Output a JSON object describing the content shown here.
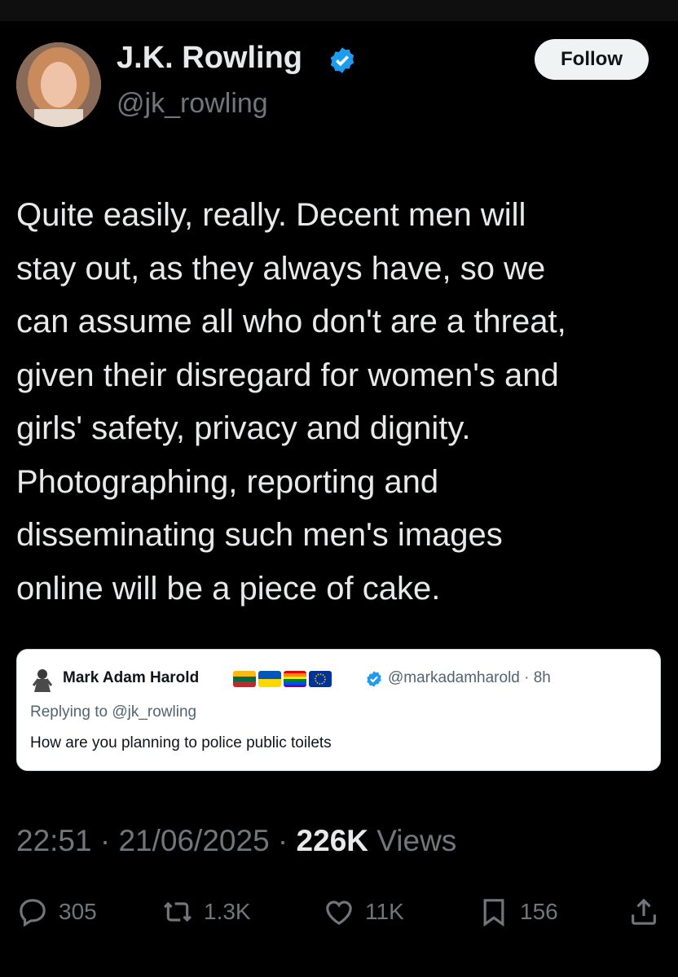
{
  "author": {
    "name": "J.K. Rowling",
    "handle": "@jk_rowling"
  },
  "follow_label": "Follow",
  "tweet_text": "Quite easily, really. Decent men will\nstay out, as they always have, so we\ncan assume all who don't are a threat,\ngiven their disregard for women's and\ngirls' safety, privacy and dignity.\nPhotographing, reporting and\ndisseminating such men's images\nonline will be a piece of cake.",
  "quote": {
    "name": "Mark Adam Harold",
    "handle_time": "@markadamharold · 8h",
    "replying": "Replying to @jk_rowling",
    "text": "How are you planning to police public toilets"
  },
  "meta": {
    "time": "22:51 · 21/06/2025 · ",
    "views_count": "226K",
    "views_label": " Views"
  },
  "stats": {
    "replies": "305",
    "reposts": "1.3K",
    "likes": "11K",
    "bookmarks": "156"
  },
  "colors": {
    "background": "#000000",
    "verified_blue": "#1d9bf0",
    "muted": "#71767b"
  }
}
